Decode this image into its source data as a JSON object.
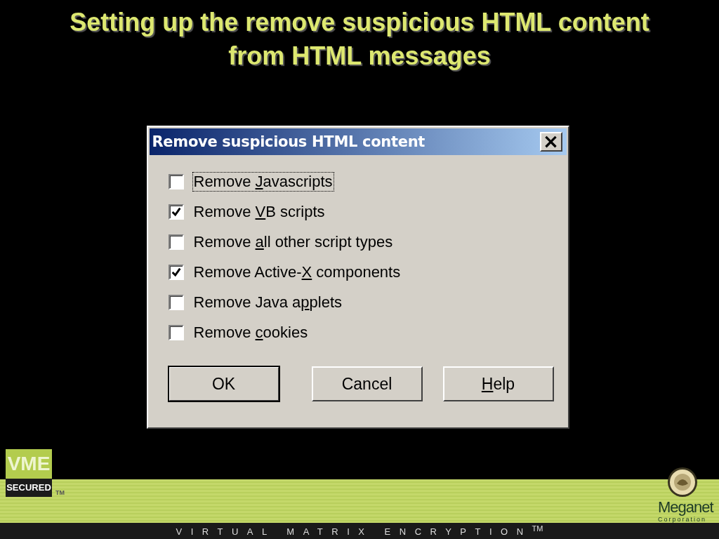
{
  "slide_title": [
    "Setting up the remove suspicious HTML content",
    "from HTML messages"
  ],
  "dialog": {
    "title": "Remove suspicious HTML content",
    "close": "×",
    "options": [
      {
        "pre": "Remove ",
        "key": "J",
        "post": "avascripts",
        "checked": false,
        "focused": true
      },
      {
        "pre": "Remove ",
        "key": "V",
        "post": "B scripts",
        "checked": true,
        "focused": false
      },
      {
        "pre": "Remove ",
        "key": "a",
        "post": "ll other script types",
        "checked": false,
        "focused": false
      },
      {
        "pre": "Remove Active-",
        "key": "X",
        "post": " components",
        "checked": true,
        "focused": false
      },
      {
        "pre": "Remove Java a",
        "key": "p",
        "post": "plets",
        "checked": false,
        "focused": false
      },
      {
        "pre": "Remove ",
        "key": "c",
        "post": "ookies",
        "checked": false,
        "focused": false
      }
    ],
    "buttons": [
      {
        "post": "OK",
        "default": true
      },
      {
        "post": "Cancel",
        "default": false
      },
      {
        "key": "H",
        "post": "elp",
        "default": false
      }
    ]
  },
  "footer": {
    "badge_top": "VME",
    "badge_bottom": "SECURED",
    "trademark": "TM",
    "company": "Meganet",
    "company_sub": "Corporation",
    "tagline": "VIRTUAL MATRIX ENCRYPTION",
    "tagline_mark": "TM"
  }
}
